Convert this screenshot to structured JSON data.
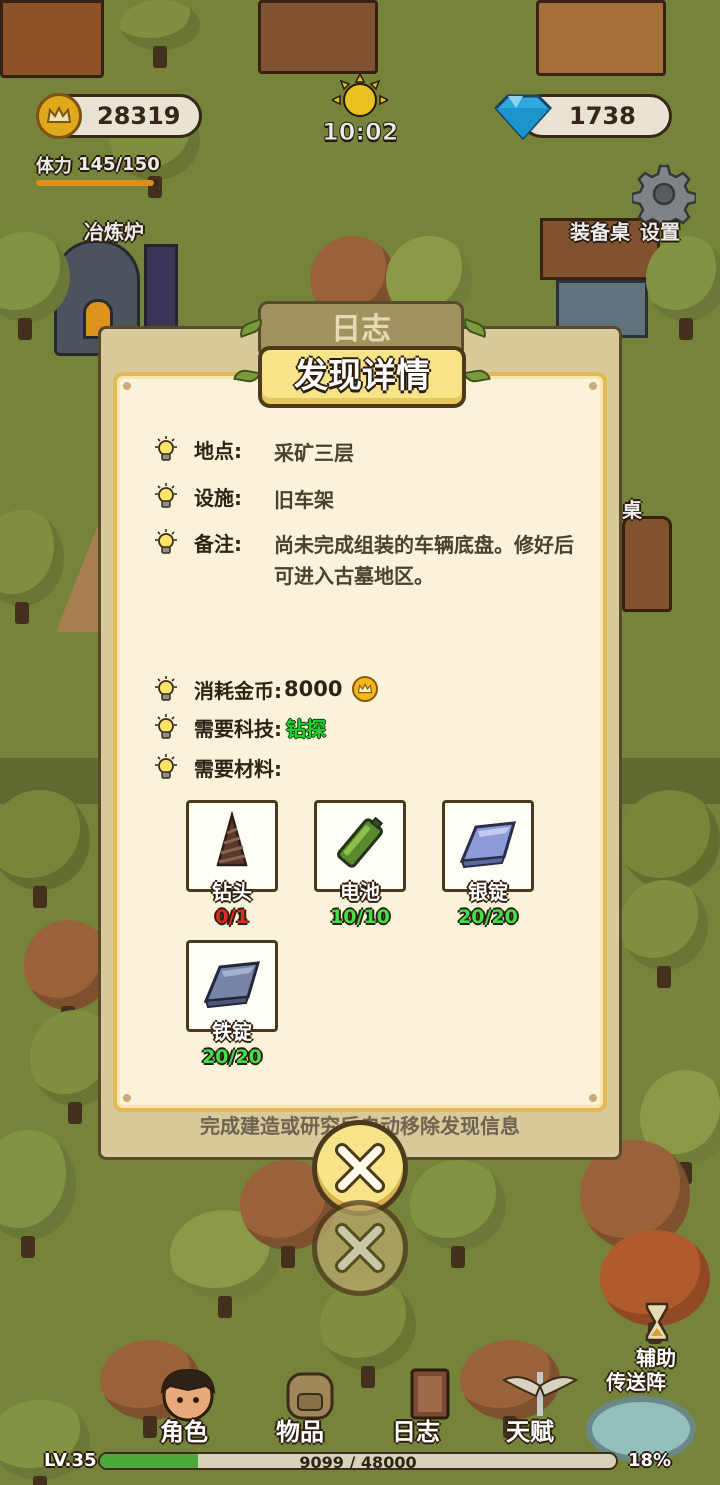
{
  "hud": {
    "gold": "28319",
    "diamonds": "1738",
    "time": "10:02",
    "stamina_label": "体力",
    "stamina_value": "145/150",
    "stamina_fraction": 0.967
  },
  "world_labels": {
    "furnace": "冶炼炉",
    "equip_table": "装备桌",
    "settings": "设置",
    "partial_label": "桌",
    "assist": "辅助",
    "teleport": "传送阵"
  },
  "modal": {
    "back_tab": "日志",
    "title": "发现详情",
    "location_label": "地点:",
    "location_value": "采矿三层",
    "facility_label": "设施:",
    "facility_value": "旧车架",
    "note_label": "备注:",
    "note_value": "尚未完成组装的车辆底盘。修好后可进入古墓地区。",
    "cost_label": "消耗金币:",
    "cost_value": "8000",
    "tech_label": "需要科技:",
    "tech_value": "钻探",
    "materials_label": "需要材料:",
    "materials": [
      {
        "name": "钻头",
        "count": "0/1",
        "status": "insufficient",
        "icon": "drill-bit-icon"
      },
      {
        "name": "电池",
        "count": "10/10",
        "status": "sufficient",
        "icon": "battery-icon"
      },
      {
        "name": "银锭",
        "count": "20/20",
        "status": "sufficient",
        "icon": "silver-ingot-icon"
      },
      {
        "name": "铁锭",
        "count": "20/20",
        "status": "sufficient",
        "icon": "iron-ingot-icon"
      }
    ],
    "footer_tip": "完成建造或研究后自动移除发现信息"
  },
  "nav": {
    "character": "角色",
    "items": "物品",
    "journal": "日志",
    "talent": "天赋"
  },
  "level": {
    "label": "LV.35",
    "xp": "9099 / 48000",
    "xp_fraction": 0.19,
    "percent": "18%"
  },
  "colors": {
    "accent_yellow": "#f8e488",
    "outline": "#4b3a1b",
    "insufficient": "#e82626",
    "sufficient": "#3fe04a",
    "tech": "#21d12d"
  }
}
